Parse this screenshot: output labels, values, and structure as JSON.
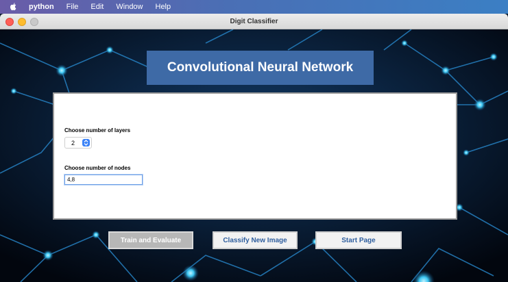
{
  "menubar": {
    "app_name": "python",
    "items": [
      "File",
      "Edit",
      "Window",
      "Help"
    ]
  },
  "window": {
    "title": "Digit Classifier"
  },
  "banner": {
    "title": "Convolutional Neural Network"
  },
  "form": {
    "layers_label": "Choose number of layers",
    "layers_value": "2",
    "nodes_label": "Choose number of nodes",
    "nodes_value": "4,8"
  },
  "buttons": {
    "train": "Train and Evaluate",
    "classify": "Classify New Image",
    "start": "Start Page"
  },
  "colors": {
    "banner_bg": "#3e6aa6",
    "button_text": "#2f5f9f",
    "stepper_accent": "#3a82f7"
  }
}
